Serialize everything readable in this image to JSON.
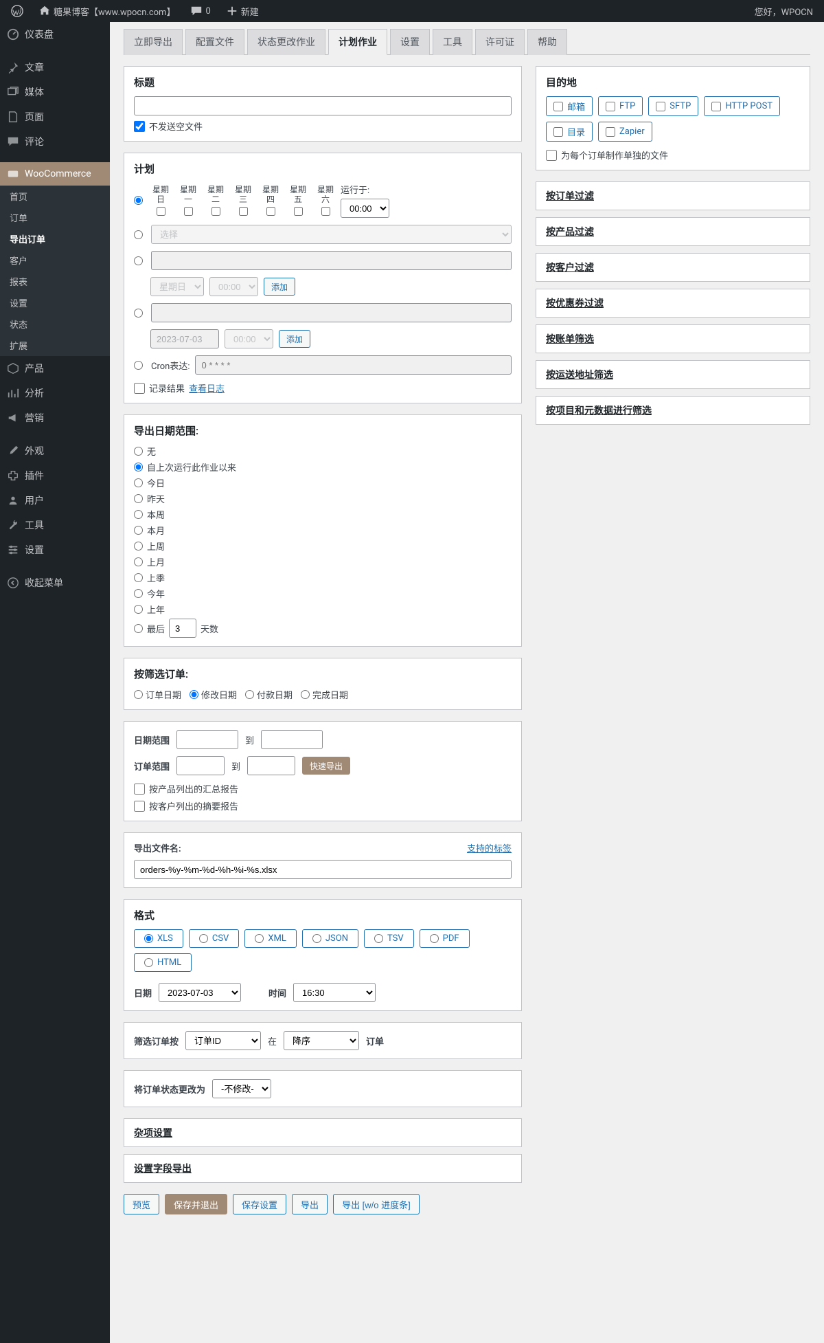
{
  "toolbar": {
    "site_name": "糖果博客【www.wpocn.com】",
    "comments": "0",
    "new": "新建",
    "greeting": "您好，WPOCN"
  },
  "sidebar": {
    "items": [
      {
        "label": "仪表盘"
      },
      {
        "label": "文章"
      },
      {
        "label": "媒体"
      },
      {
        "label": "页面"
      },
      {
        "label": "评论"
      },
      {
        "label": "WooCommerce"
      },
      {
        "label": "产品"
      },
      {
        "label": "分析"
      },
      {
        "label": "营销"
      },
      {
        "label": "外观"
      },
      {
        "label": "插件"
      },
      {
        "label": "用户"
      },
      {
        "label": "工具"
      },
      {
        "label": "设置"
      },
      {
        "label": "收起菜单"
      }
    ],
    "sub": {
      "home": "首页",
      "orders": "订单",
      "export_orders": "导出订单",
      "customers": "客户",
      "reports": "报表",
      "settings": "设置",
      "status": "状态",
      "extensions": "扩展"
    }
  },
  "tabs": {
    "export_now": "立即导出",
    "profiles": "配置文件",
    "status_jobs": "状态更改作业",
    "scheduled_jobs": "计划作业",
    "settings": "设置",
    "tools": "工具",
    "license": "许可证",
    "help": "帮助"
  },
  "title_panel": {
    "label": "标题",
    "no_empty": "不发送空文件"
  },
  "schedule": {
    "title": "计划",
    "days": [
      "星期日",
      "星期一",
      "星期二",
      "星期三",
      "星期四",
      "星期五",
      "星期六"
    ],
    "run_at": "运行于:",
    "time": "00:00",
    "select_placeholder": "选择",
    "weekday": "星期日",
    "weekday_time": "00:00",
    "add": "添加",
    "date_val": "2023-07-03",
    "date_time": "00:00",
    "cron_label": "Cron表达:",
    "cron_placeholder": "0 * * * *",
    "record_results": "记录结果",
    "view_log": "查看日志"
  },
  "date_range": {
    "title": "导出日期范围:",
    "none": "无",
    "since_last": "自上次运行此作业以来",
    "today": "今日",
    "yesterday": "昨天",
    "this_week": "本周",
    "this_month": "本月",
    "last_week": "上周",
    "last_month": "上月",
    "last_quarter": "上季",
    "this_year": "今年",
    "last_year": "上年",
    "last_n": "最后",
    "last_n_val": "3",
    "days_suffix": "天数"
  },
  "filter_orders": {
    "title": "按筛选订单:",
    "order_date": "订单日期",
    "mod_date": "修改日期",
    "paid_date": "付款日期",
    "complete_date": "完成日期"
  },
  "range_form": {
    "date_range": "日期范围",
    "to": "到",
    "order_range": "订单范围",
    "quick_export": "快速导出",
    "by_product": "按产品列出的汇总报告",
    "by_customer": "按客户列出的摘要报告"
  },
  "filename": {
    "label": "导出文件名:",
    "tags_link": "支持的标签",
    "value": "orders-%y-%m-%d-%h-%i-%s.xlsx"
  },
  "format": {
    "title": "格式",
    "xls": "XLS",
    "csv": "CSV",
    "xml": "XML",
    "json": "JSON",
    "tsv": "TSV",
    "pdf": "PDF",
    "html": "HTML",
    "date_label": "日期",
    "date_val": "2023-07-03",
    "time_label": "时间",
    "time_val": "16:30"
  },
  "sort": {
    "label": "筛选订单按",
    "field": "订单ID",
    "in": "在",
    "dir": "降序",
    "suffix": "订单"
  },
  "status_change": {
    "label": "将订单状态更改为",
    "value": "-不修改-"
  },
  "misc": {
    "title": "杂项设置"
  },
  "fields": {
    "title": "设置字段导出"
  },
  "actions": {
    "preview": "预览",
    "save_exit": "保存并退出",
    "save_settings": "保存设置",
    "export": "导出",
    "export_noprog": "导出 [w/o 进度条]"
  },
  "dest": {
    "title": "目的地",
    "email": "邮箱",
    "ftp": "FTP",
    "sftp": "SFTP",
    "http": "HTTP POST",
    "dir": "目录",
    "zapier": "Zapier",
    "separate_files": "为每个订单制作单独的文件"
  },
  "filters": {
    "by_order": "按订单过滤",
    "by_product": "按产品过滤",
    "by_customer": "按客户过滤",
    "by_coupon": "按优惠券过滤",
    "by_billing": "按账单筛选",
    "by_shipping": "按运送地址筛选",
    "by_meta": "按项目和元数据进行筛选"
  }
}
